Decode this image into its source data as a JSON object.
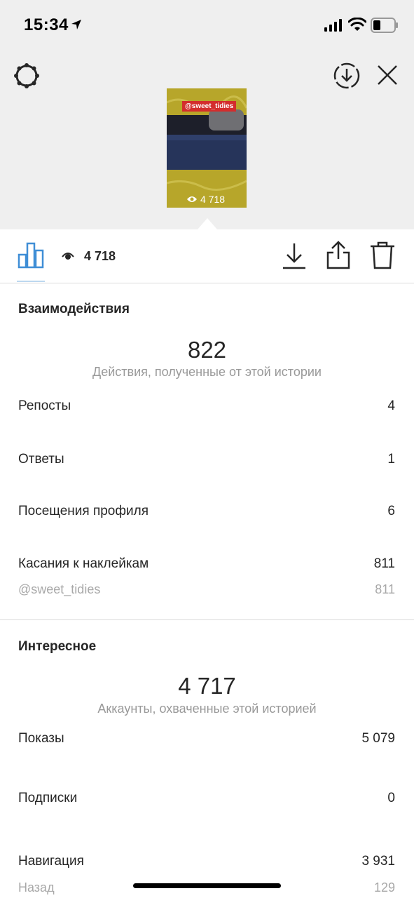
{
  "status_bar": {
    "time": "15:34"
  },
  "story": {
    "sticker": "@sweet_tidies",
    "views": "4 718"
  },
  "toolbar": {
    "views_count": "4 718"
  },
  "interactions": {
    "title": "Взаимодействия",
    "total": "822",
    "subtitle": "Действия, полученные от этой истории",
    "rows": [
      {
        "label": "Репосты",
        "value": "4"
      },
      {
        "label": "Ответы",
        "value": "1"
      },
      {
        "label": "Посещения профиля",
        "value": "6"
      },
      {
        "label": "Касания к наклейкам",
        "value": "811"
      }
    ],
    "sub_row": {
      "label": "@sweet_tidies",
      "value": "811"
    }
  },
  "discovery": {
    "title": "Интересное",
    "total": "4 717",
    "subtitle": "Аккаунты, охваченные этой историей",
    "rows": [
      {
        "label": "Показы",
        "value": "5 079"
      },
      {
        "label": "Подписки",
        "value": "0"
      },
      {
        "label": "Навигация",
        "value": "3 931"
      }
    ],
    "sub_row": {
      "label": "Назад",
      "value": "129"
    }
  },
  "colors": {
    "accent_blue": "#3f8ed6",
    "background_gray": "#efefef",
    "sticker_red": "#d32d2d"
  }
}
